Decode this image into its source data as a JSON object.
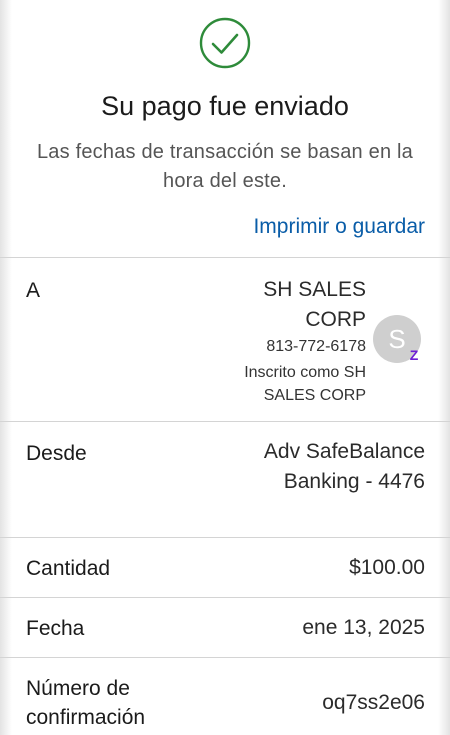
{
  "status": {
    "icon": "check-circle-icon",
    "title": "Su pago fue enviado",
    "subtitle": "Las fechas de transacción se basan en la hora del este.",
    "print_link": "Imprimir o guardar"
  },
  "colors": {
    "success": "#2e8b3a",
    "link": "#0a5da8",
    "zelle_purple": "#6d1ed4",
    "avatar_bg": "#cfcfcf"
  },
  "details": {
    "to": {
      "label": "A",
      "name": "SH SALES CORP",
      "phone": "813-772-6178",
      "enrolled": "Inscrito como SH SALES CORP",
      "avatar_letter": "S",
      "badge_icon": "zelle-icon",
      "badge_glyph": "Z"
    },
    "from": {
      "label": "Desde",
      "value": "Adv SafeBalance Banking - 4476"
    },
    "amount": {
      "label": "Cantidad",
      "value": "$100.00"
    },
    "date": {
      "label": "Fecha",
      "value": "ene 13, 2025"
    },
    "confirmation": {
      "label": "Número de confirmación",
      "value": "oq7ss2e06"
    }
  }
}
